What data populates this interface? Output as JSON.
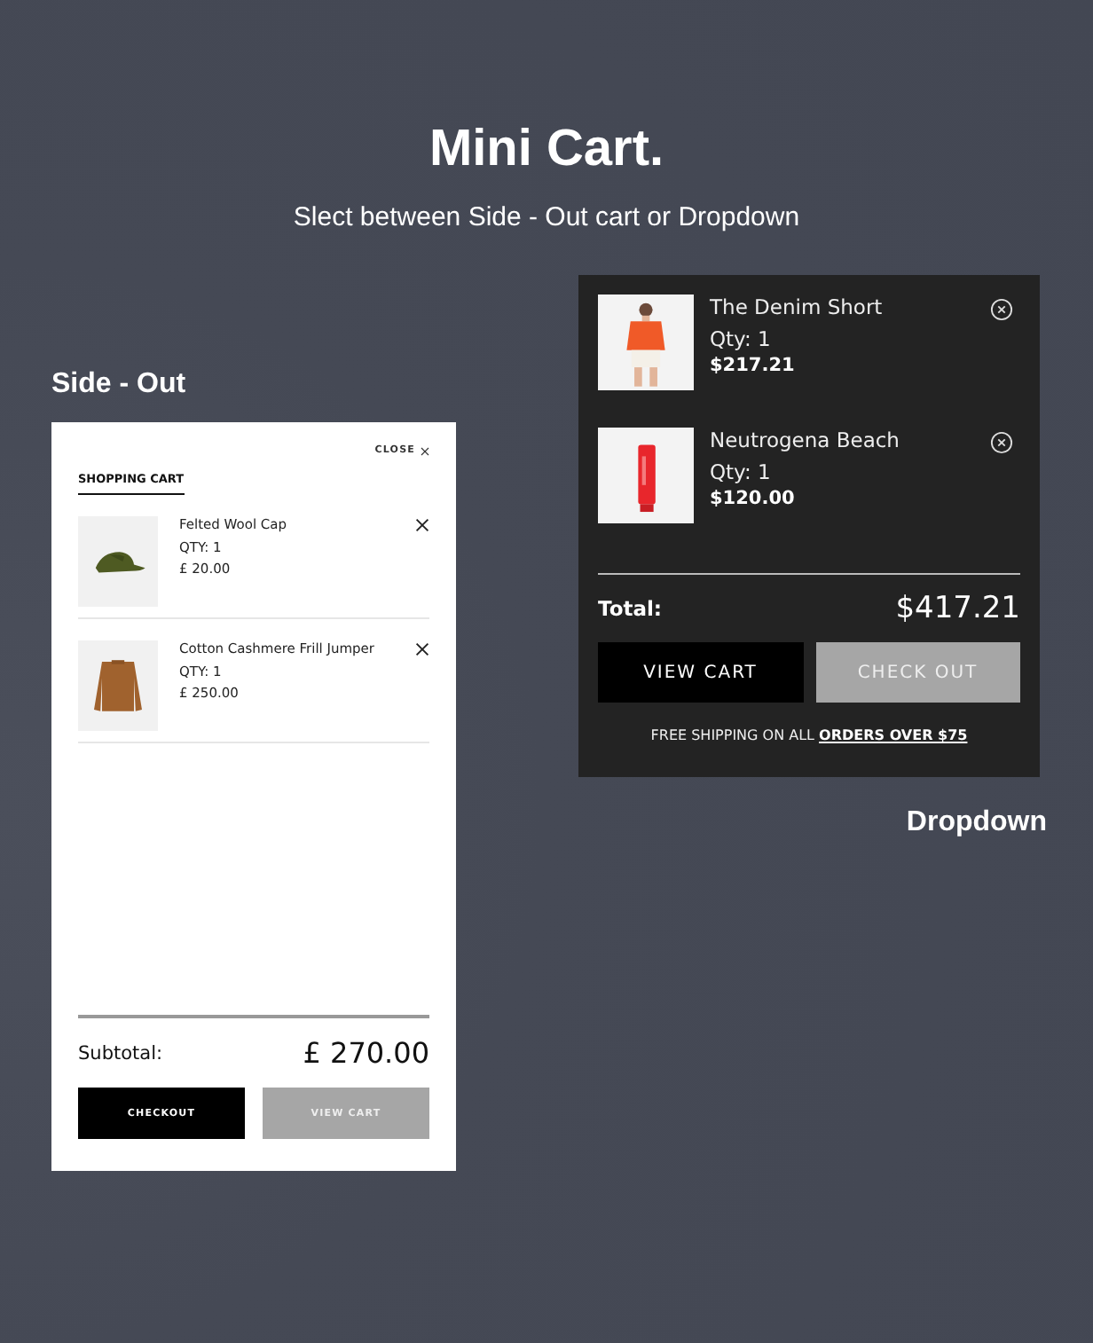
{
  "header": {
    "title": "Mini Cart.",
    "subtitle": "Slect between Side - Out cart or Dropdown"
  },
  "side_out": {
    "label": "Side - Out",
    "close": "CLOSE",
    "heading": "SHOPPING CART",
    "items": [
      {
        "name": "Felted Wool Cap",
        "qty": "QTY: 1",
        "price": "£ 20.00"
      },
      {
        "name": "Cotton Cashmere Frill Jumper",
        "qty": "QTY: 1",
        "price": "£ 250.00"
      }
    ],
    "subtotal_label": "Subtotal:",
    "subtotal": "£ 270.00",
    "buttons": [
      {
        "label": "CHECKOUT",
        "kind": "primary"
      },
      {
        "label": "VIEW CART",
        "kind": "secondary"
      }
    ]
  },
  "dropdown": {
    "label": "Dropdown",
    "items": [
      {
        "name": "The Denim Short",
        "qty": "Qty: 1",
        "price": "$217.21"
      },
      {
        "name": "Neutrogena Beach",
        "qty": "Qty: 1",
        "price": "$120.00"
      }
    ],
    "total_label": "Total:",
    "total": "$417.21",
    "buttons": [
      {
        "label": "VIEW CART",
        "kind": "primary"
      },
      {
        "label": "CHECK OUT",
        "kind": "secondary"
      }
    ],
    "shipping_text": "FREE SHIPPING ON ALL",
    "shipping_link": "ORDERS OVER $75"
  }
}
